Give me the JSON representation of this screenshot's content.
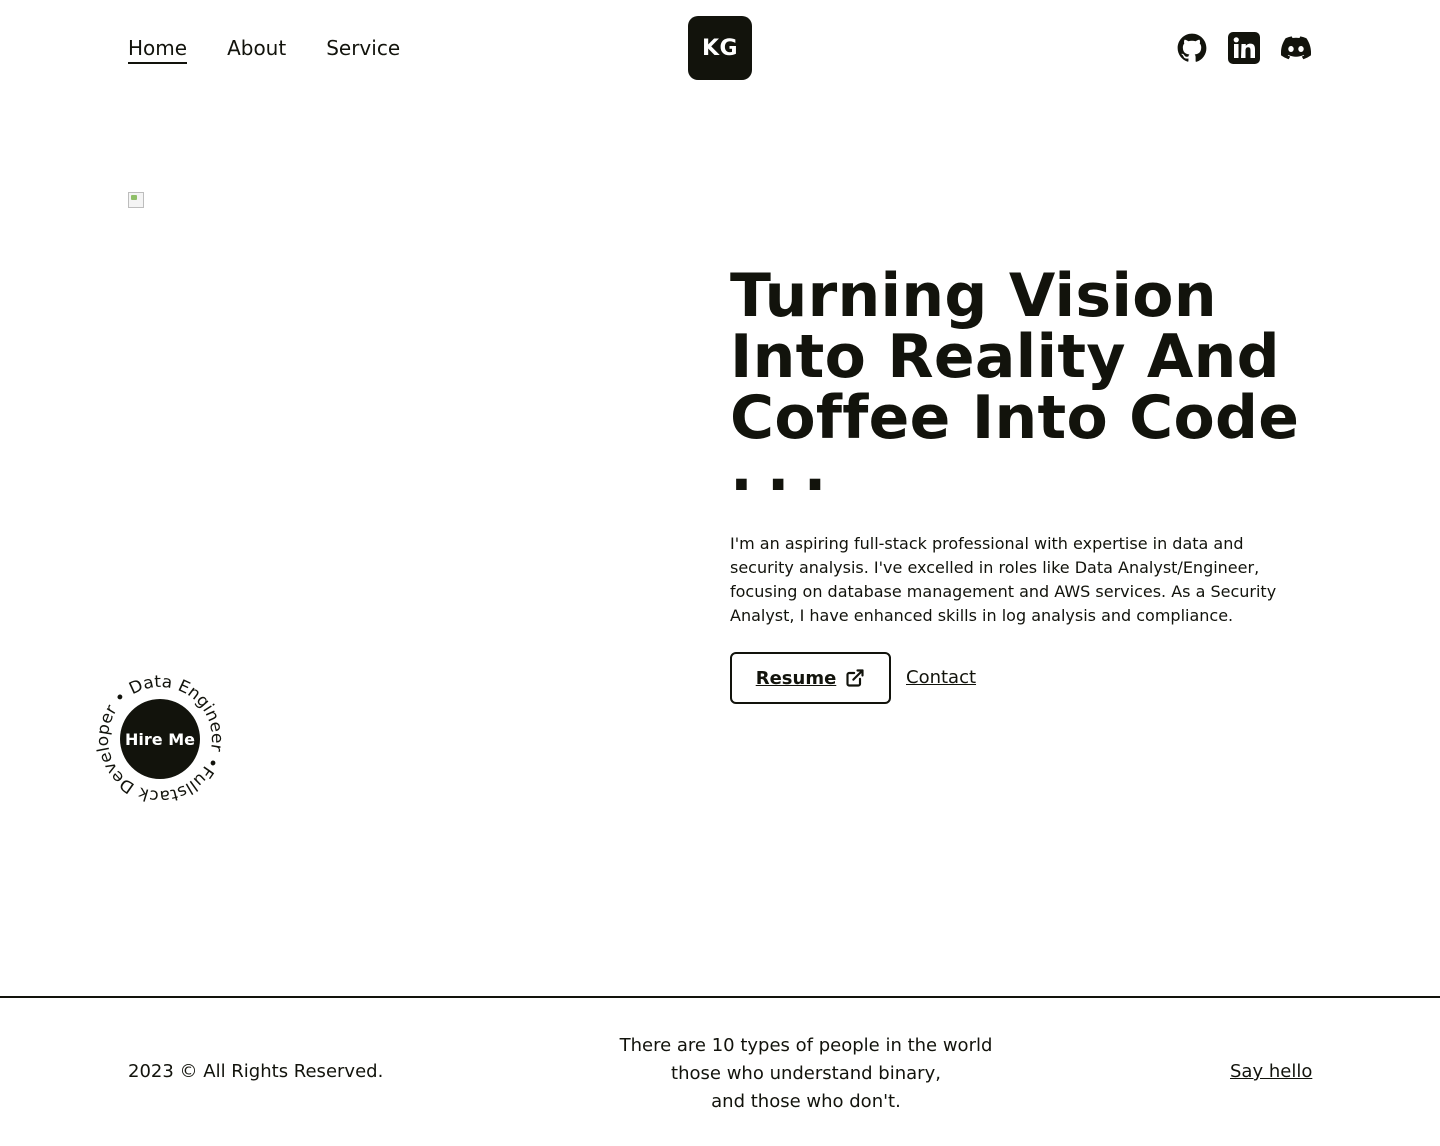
{
  "header": {
    "nav": [
      {
        "label": "Home",
        "active": true
      },
      {
        "label": "About",
        "active": false
      },
      {
        "label": "Service",
        "active": false
      }
    ],
    "logo_text": "KG",
    "socials": [
      {
        "name": "github-icon"
      },
      {
        "name": "linkedin-icon"
      },
      {
        "name": "discord-icon"
      }
    ]
  },
  "hero": {
    "headline": "Turning Vision Into Reality And Coffee Into Code",
    "headline_suffix": "...",
    "intro": "I'm an aspiring full-stack professional with expertise in data and security analysis. I've excelled in roles like Data Analyst/Engineer, focusing on database management and AWS services. As a Security Analyst, I have enhanced skills in log analysis and compliance.",
    "resume_label": "Resume",
    "contact_label": "Contact"
  },
  "badge": {
    "label": "Hire Me",
    "ring_text": "Fullstack Developer • Data Engineer •"
  },
  "footer": {
    "copyright": "2023 © All Rights Reserved.",
    "joke_lines": [
      "There are 10 types of people in the world",
      "those who understand binary,",
      "and those who don't."
    ],
    "say_hello": "Say hello"
  },
  "colors": {
    "primary": "#12130c",
    "background": "#ffffff"
  }
}
